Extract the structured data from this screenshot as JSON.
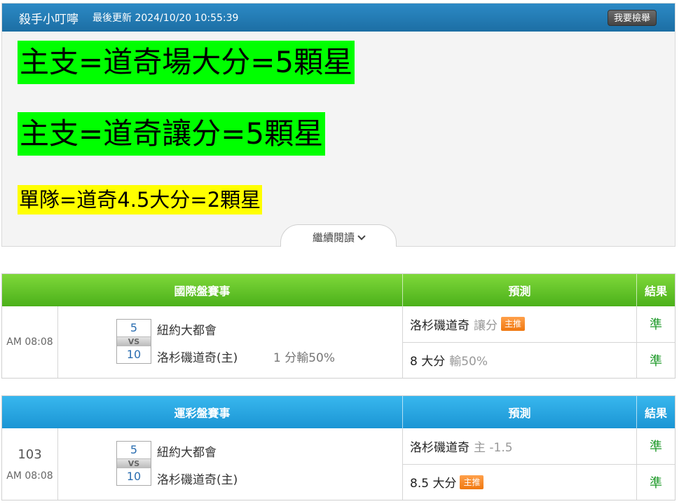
{
  "article": {
    "author": "殺手小叮嚀",
    "updated": "最後更新 2024/10/20 10:55:39",
    "report_label": "我要檢舉",
    "line1": "主支=道奇場大分=5顆星",
    "line2": "主支=道奇讓分=5顆星",
    "line3": "單隊=道奇4.5大分=2顆星",
    "more_label": "繼續閱讀",
    "colors": {
      "header": "#1c6ea4",
      "highlight_green": "#00ff00",
      "highlight_yellow": "#ffff00"
    }
  },
  "intl": {
    "header": {
      "match": "國際盤賽事",
      "prediction": "預測",
      "result": "結果"
    },
    "time": "AM 08:08",
    "team1": {
      "name": "紐約大都會",
      "score": "5"
    },
    "vs": "VS",
    "team2": {
      "name": "洛杉磯道奇(主)",
      "score": "10"
    },
    "spread": "1 分輸50%",
    "predictions": [
      {
        "main": "洛杉磯道奇",
        "sub": "讓分",
        "badge": "主推",
        "result": "準"
      },
      {
        "main": "8 大分",
        "sub": "輸50%",
        "badge": "",
        "result": "準"
      }
    ],
    "color": "#4bb01a"
  },
  "sports": {
    "header": {
      "match": "運彩盤賽事",
      "prediction": "預測",
      "result": "結果"
    },
    "game_no": "103",
    "time": "AM 08:08",
    "team1": {
      "name": "紐約大都會",
      "score": "5"
    },
    "vs": "VS",
    "team2": {
      "name": "洛杉磯道奇(主)",
      "score": "10"
    },
    "predictions": [
      {
        "main": "洛杉磯道奇",
        "sub": "主 -1.5",
        "badge": "",
        "result": "準"
      },
      {
        "main": "8.5 大分",
        "sub": "",
        "badge": "主推",
        "result": "準"
      }
    ],
    "color": "#1b95d4"
  }
}
